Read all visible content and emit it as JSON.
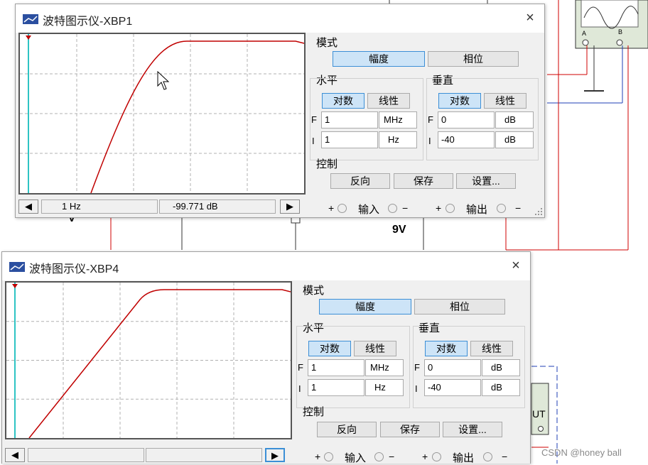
{
  "colors": {
    "curve": "#c00000",
    "wire_red": "#d00000",
    "wire_blue": "#1f3fb5",
    "wire_dark_red": "#a00000"
  },
  "background": {
    "battery_label": "9V",
    "component_partial_label": "UT",
    "watermark": "CSDN @honey ball",
    "scope_terminal_a": "A",
    "scope_terminal_b": "B",
    "partial_label": "V"
  },
  "windows": [
    {
      "icon": "bode-plotter-icon",
      "title": "波特图示仪-XBP1",
      "close_glyph": "×",
      "mode_label": "模式",
      "mode_buttons": [
        "幅度",
        "相位"
      ],
      "horizontal_label": "水平",
      "vertical_label": "垂直",
      "scale_buttons": [
        "对数",
        "线性"
      ],
      "h_f_label": "F",
      "h_i_label": "I",
      "h_f_value": "1",
      "h_f_unit": "MHz",
      "h_i_value": "1",
      "h_i_unit": "Hz",
      "v_f_label": "F",
      "v_i_label": "I",
      "v_f_value": "0",
      "v_f_unit": "dB",
      "v_i_value": "-40",
      "v_i_unit": "dB",
      "control_label": "控制",
      "control_buttons": [
        "反向",
        "保存",
        "设置..."
      ],
      "status_freq": "1 Hz",
      "status_mag": "-99.771 dB",
      "left_arrow": "◀",
      "right_arrow": "▶",
      "plus": "+",
      "minus": "−",
      "input_label": "输入",
      "output_label": "输出",
      "curve": {
        "start_frac": 0.25,
        "knee_frac": 0.55,
        "rise_shape": "concave"
      }
    },
    {
      "icon": "bode-plotter-icon",
      "title": "波特图示仪-XBP4",
      "close_glyph": "×",
      "mode_label": "模式",
      "mode_buttons": [
        "幅度",
        "相位"
      ],
      "horizontal_label": "水平",
      "vertical_label": "垂直",
      "scale_buttons": [
        "对数",
        "线性"
      ],
      "h_f_label": "F",
      "h_i_label": "I",
      "h_f_value": "1",
      "h_f_unit": "MHz",
      "h_i_value": "1",
      "h_i_unit": "Hz",
      "v_f_label": "F",
      "v_i_label": "I",
      "v_f_value": "0",
      "v_f_unit": "dB",
      "v_i_value": "-40",
      "v_i_unit": "dB",
      "control_label": "控制",
      "control_buttons": [
        "反向",
        "保存",
        "设置..."
      ],
      "status_freq": "",
      "status_mag": "",
      "left_arrow": "◀",
      "right_arrow": "▶",
      "plus": "+",
      "minus": "−",
      "input_label": "输入",
      "output_label": "输出",
      "curve": {
        "start_frac": 0.08,
        "knee_frac": 0.5,
        "rise_shape": "linear"
      }
    }
  ]
}
